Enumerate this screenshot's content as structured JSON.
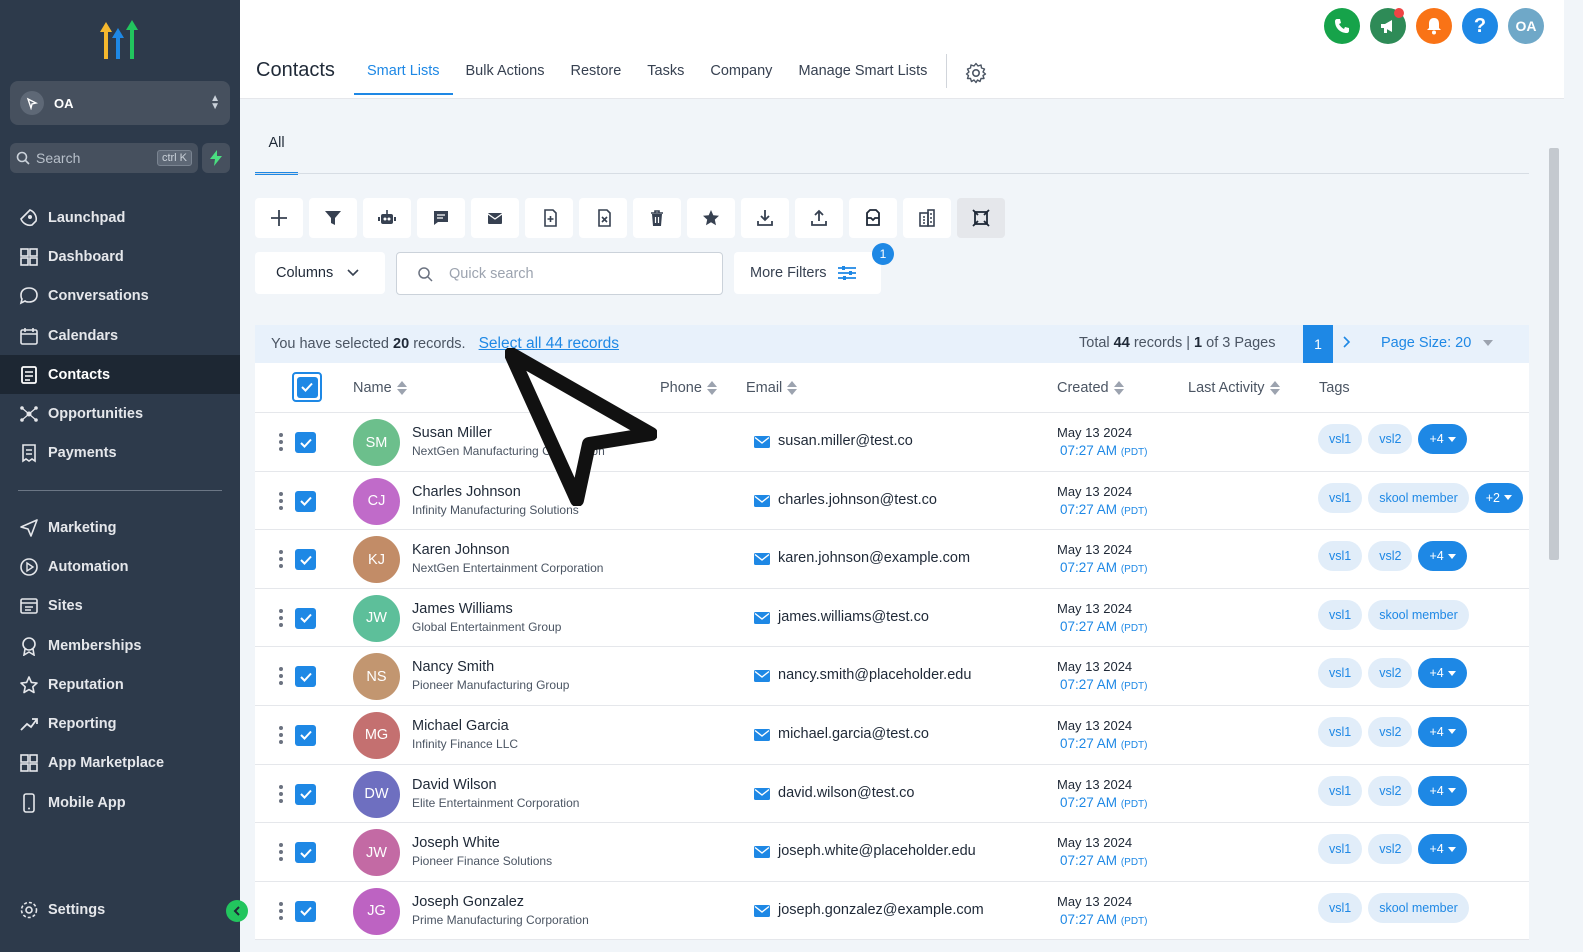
{
  "sidebar": {
    "account": "OA",
    "search_label": "Search",
    "search_shortcut": "ctrl K",
    "nav_top": [
      {
        "label": "Launchpad",
        "icon": "rocket-icon"
      },
      {
        "label": "Dashboard",
        "icon": "grid-icon"
      },
      {
        "label": "Conversations",
        "icon": "chat-icon"
      },
      {
        "label": "Calendars",
        "icon": "calendar-icon"
      },
      {
        "label": "Contacts",
        "icon": "contact-card-icon",
        "active": true
      },
      {
        "label": "Opportunities",
        "icon": "network-icon"
      },
      {
        "label": "Payments",
        "icon": "receipt-icon"
      }
    ],
    "nav_bottom": [
      {
        "label": "Marketing",
        "icon": "send-icon"
      },
      {
        "label": "Automation",
        "icon": "play-circle-icon"
      },
      {
        "label": "Sites",
        "icon": "browser-icon"
      },
      {
        "label": "Memberships",
        "icon": "award-icon"
      },
      {
        "label": "Reputation",
        "icon": "star-icon"
      },
      {
        "label": "Reporting",
        "icon": "trend-icon"
      },
      {
        "label": "App Marketplace",
        "icon": "apps-icon"
      },
      {
        "label": "Mobile App",
        "icon": "phone-icon"
      }
    ],
    "settings": "Settings"
  },
  "header": {
    "title": "Contacts",
    "tabs": [
      "Smart Lists",
      "Bulk Actions",
      "Restore",
      "Tasks",
      "Company",
      "Manage Smart Lists"
    ],
    "active_tab": "Smart Lists",
    "avatar_initials": "OA",
    "help": "?"
  },
  "colors": {
    "accent": "#1e88e5",
    "phone": "#16a34a",
    "announce": "#2e8b57",
    "notify": "#f97316",
    "help": "#1e88e5",
    "avatar": "#6fa8c8"
  },
  "main": {
    "subtab": "All",
    "toolbar_icons": [
      "add-icon",
      "filter-icon",
      "robot-icon",
      "message-icon",
      "email-icon",
      "tag-add-icon",
      "tag-remove-icon",
      "trash-icon",
      "star-icon",
      "download-icon",
      "upload-icon",
      "archive-icon",
      "building-icon",
      "merge-icon"
    ],
    "columns_label": "Columns",
    "search_placeholder": "Quick search",
    "more_filters": "More Filters",
    "filter_count": "1",
    "selection": {
      "prefix": "You have selected",
      "count": "20",
      "suffix": "records.",
      "select_all": "Select all 44 records"
    },
    "pagination": {
      "total_prefix": "Total",
      "total": "44",
      "records_word": "records |",
      "page": "1",
      "of_word": "of 3 Pages",
      "page_size": "Page Size: 20"
    },
    "columns": [
      "Name",
      "Phone",
      "Email",
      "Created",
      "Last Activity",
      "Tags"
    ],
    "rows": [
      {
        "initials": "SM",
        "color": "#6cbf8c",
        "name": "Susan Miller",
        "company": "NextGen Manufacturing Corporation",
        "email": "susan.miller@test.co",
        "date": "May 13 2024",
        "time": "07:27 AM",
        "tz": "(PDT)",
        "tags": [
          "vsl1",
          "vsl2"
        ],
        "more": "+4"
      },
      {
        "initials": "CJ",
        "color": "#c06bc9",
        "name": "Charles Johnson",
        "company": "Infinity Manufacturing Solutions",
        "email": "charles.johnson@test.co",
        "date": "May 13 2024",
        "time": "07:27 AM",
        "tz": "(PDT)",
        "tags": [
          "vsl1",
          "skool member"
        ],
        "more": "+2"
      },
      {
        "initials": "KJ",
        "color": "#c28c67",
        "name": "Karen Johnson",
        "company": "NextGen Entertainment Corporation",
        "email": "karen.johnson@example.com",
        "date": "May 13 2024",
        "time": "07:27 AM",
        "tz": "(PDT)",
        "tags": [
          "vsl1",
          "vsl2"
        ],
        "more": "+4"
      },
      {
        "initials": "JW",
        "color": "#5dbf9a",
        "name": "James Williams",
        "company": "Global Entertainment Group",
        "email": "james.williams@test.co",
        "date": "May 13 2024",
        "time": "07:27 AM",
        "tz": "(PDT)",
        "tags": [
          "vsl1",
          "skool member"
        ],
        "more": ""
      },
      {
        "initials": "NS",
        "color": "#c29670",
        "name": "Nancy Smith",
        "company": "Pioneer Manufacturing Group",
        "email": "nancy.smith@placeholder.edu",
        "date": "May 13 2024",
        "time": "07:27 AM",
        "tz": "(PDT)",
        "tags": [
          "vsl1",
          "vsl2"
        ],
        "more": "+4"
      },
      {
        "initials": "MG",
        "color": "#c47070",
        "name": "Michael Garcia",
        "company": "Infinity Finance LLC",
        "email": "michael.garcia@test.co",
        "date": "May 13 2024",
        "time": "07:27 AM",
        "tz": "(PDT)",
        "tags": [
          "vsl1",
          "vsl2"
        ],
        "more": "+4"
      },
      {
        "initials": "DW",
        "color": "#6e6fc0",
        "name": "David Wilson",
        "company": "Elite Entertainment Corporation",
        "email": "david.wilson@test.co",
        "date": "May 13 2024",
        "time": "07:27 AM",
        "tz": "(PDT)",
        "tags": [
          "vsl1",
          "vsl2"
        ],
        "more": "+4"
      },
      {
        "initials": "JW",
        "color": "#c36aa4",
        "name": "Joseph White",
        "company": "Pioneer Finance Solutions",
        "email": "joseph.white@placeholder.edu",
        "date": "May 13 2024",
        "time": "07:27 AM",
        "tz": "(PDT)",
        "tags": [
          "vsl1",
          "vsl2"
        ],
        "more": "+4"
      },
      {
        "initials": "JG",
        "color": "#bd63c2",
        "name": "Joseph Gonzalez",
        "company": "Prime Manufacturing Corporation",
        "email": "joseph.gonzalez@example.com",
        "date": "May 13 2024",
        "time": "07:27 AM",
        "tz": "(PDT)",
        "tags": [
          "vsl1",
          "skool member"
        ],
        "more": ""
      }
    ]
  }
}
